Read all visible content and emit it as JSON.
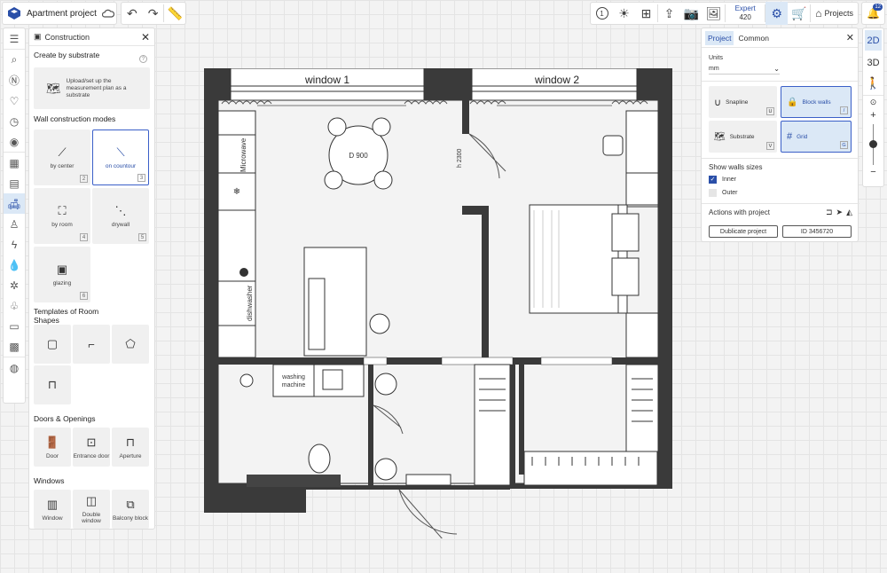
{
  "project": {
    "title": "Apartment project"
  },
  "toolbar": {
    "level_badge": "1",
    "expert_label": "Expert",
    "expert_points": "420",
    "projects_label": "Projects",
    "notifications_count": "12"
  },
  "construction_panel": {
    "title": "Construction",
    "create_by_substrate": "Create by substrate",
    "upload_label": "Upload/set up the measurement plan as a substrate",
    "wall_modes_title": "Wall construction modes",
    "wall_modes": [
      {
        "label": "by center",
        "num": "2"
      },
      {
        "label": "on countour",
        "num": "3"
      },
      {
        "label": "by room",
        "num": "4"
      },
      {
        "label": "drywall",
        "num": "5"
      },
      {
        "label": "glazing",
        "num": "6"
      }
    ],
    "templates_title": "Templates of Room Shapes",
    "doors_title": "Doors & Openings",
    "doors": [
      "Door",
      "Entrance door",
      "Aperture"
    ],
    "windows_title": "Windows",
    "windows": [
      "Window",
      "Double window",
      "Balcony block"
    ]
  },
  "right_panel": {
    "tab_project": "Project",
    "tab_common": "Common",
    "units_label": "Units",
    "units_value": "mm",
    "buttons": [
      {
        "label": "Snapline",
        "key": "U"
      },
      {
        "label": "Block walls",
        "key": "/"
      },
      {
        "label": "Substrate",
        "key": "V"
      },
      {
        "label": "Grid",
        "key": "G"
      }
    ],
    "show_walls_title": "Show walls sizes",
    "inner_label": "Inner",
    "outer_label": "Outer",
    "actions_title": "Actions with project",
    "duplicate_label": "Dublicate project",
    "id_label": "ID 3456720"
  },
  "view_rail": {
    "mode_2d": "2D",
    "mode_3d": "3D"
  },
  "floorplan": {
    "window1": "window 1",
    "window2": "window 2",
    "table": "D 900",
    "height": "h 2300",
    "microwave": "Microwave",
    "dishwasher": "dishwasher",
    "washing_machine_line1": "washing",
    "washing_machine_line2": "machine"
  },
  "colors": {
    "accent": "#2a4fa8",
    "wall": "#3a3a3a",
    "selected_bg": "#dbe8f6"
  }
}
